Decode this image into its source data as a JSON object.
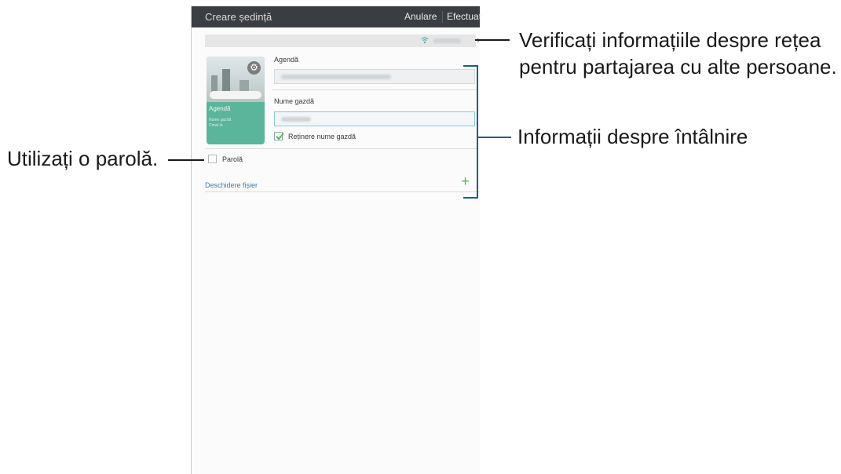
{
  "app": {
    "title": "Creare ședință",
    "cancel_label": "Anulare",
    "done_label": "Efectuat"
  },
  "network_bar": {
    "wifi_icon": "wifi-icon",
    "chevron_icon": "chevron-right-icon"
  },
  "thumbnail": {
    "agenda_label": "Agendă",
    "host_label": "Nume gazdă",
    "created_label": "Creat la",
    "settings_icon": "gear-icon",
    "accent_color": "#5bb59a"
  },
  "form": {
    "agenda_label": "Agendă",
    "host_label": "Nume gazdă",
    "remember_host_label": "Reținere nume gazdă",
    "remember_host_checked": true,
    "password_label": "Parolă",
    "password_checked": false,
    "open_file_label": "Deschidere fișier",
    "add_icon": "plus-icon"
  },
  "annotations": {
    "network_info_line1": "Verificați informațiile despre rețea",
    "network_info_line2": "pentru partajarea cu alte persoane.",
    "meeting_info": "Informații despre întâlnire",
    "use_password": "Utilizați o parolă."
  }
}
